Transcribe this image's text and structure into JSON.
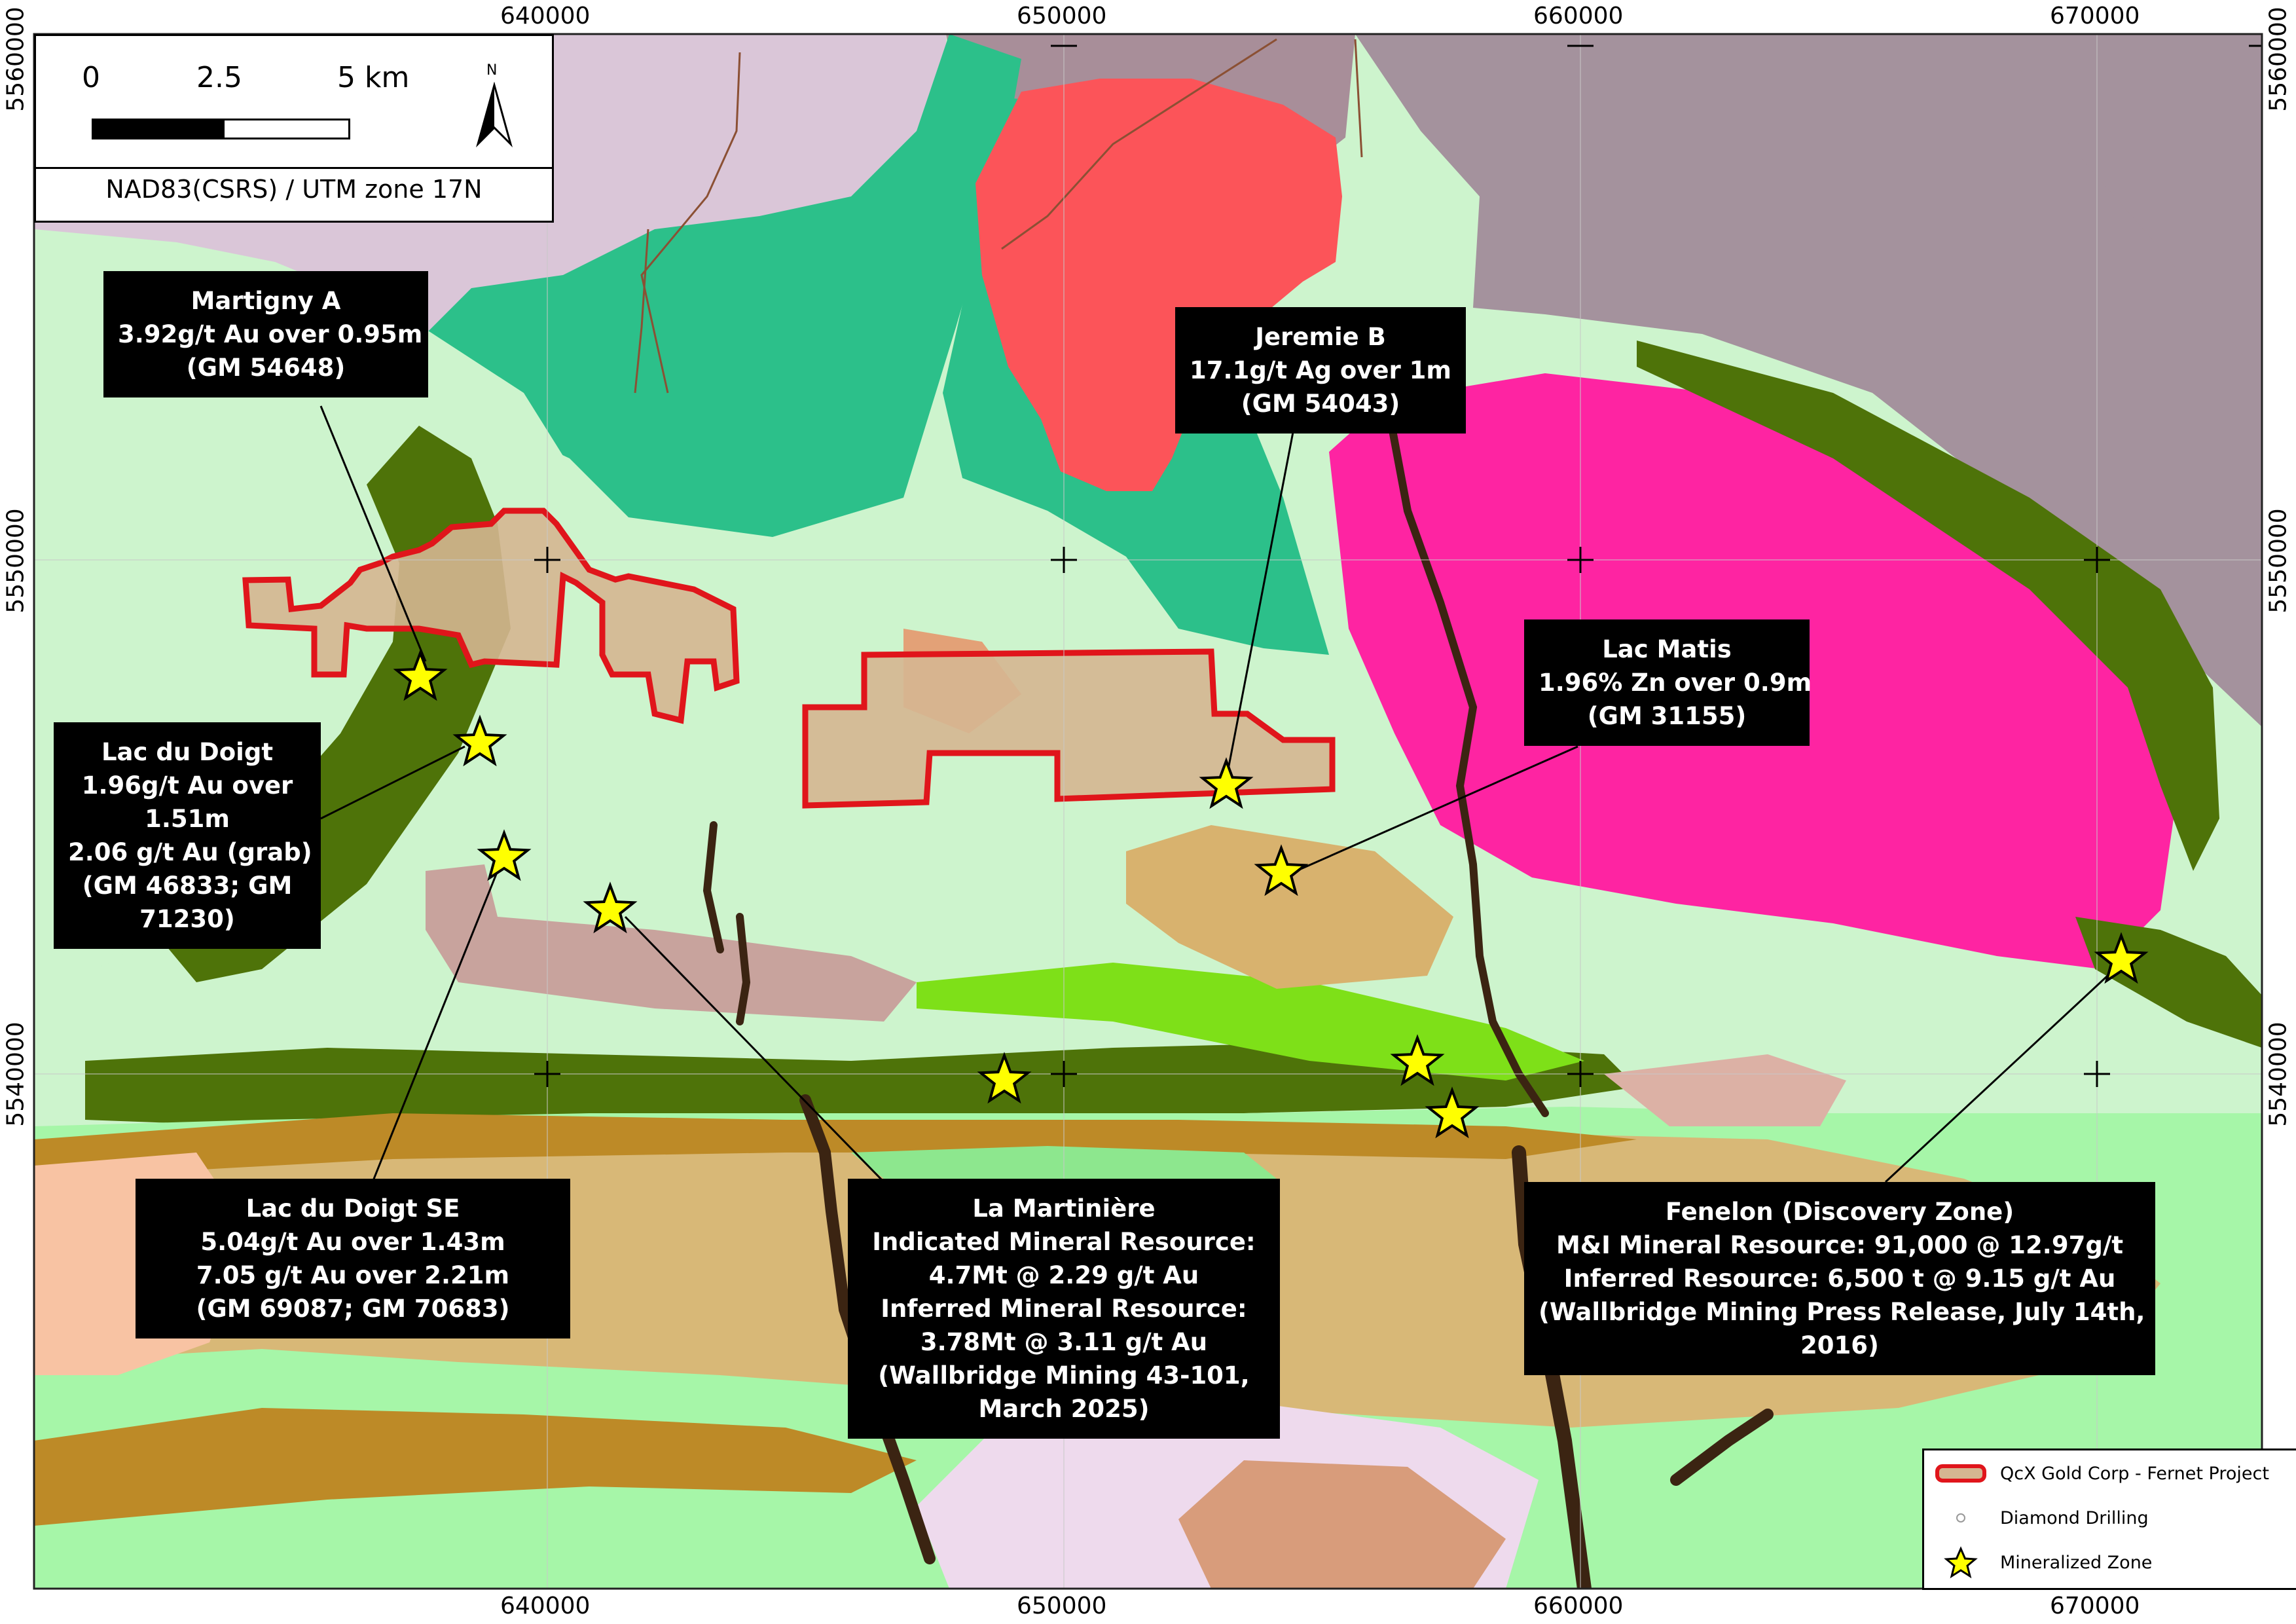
{
  "axes": {
    "x_ticks": [
      "640000",
      "650000",
      "660000",
      "670000"
    ],
    "y_ticks": [
      "5560000",
      "5550000",
      "5540000"
    ]
  },
  "scale_bar": {
    "labels": [
      "0",
      "2.5",
      "5 km"
    ],
    "north": "N",
    "crs": "NAD83(CSRS) / UTM zone 17N"
  },
  "callouts": {
    "martigny_a": [
      "Martigny A",
      "3.92g/t Au over 0.95m",
      "(GM 54648)"
    ],
    "jeremie_b": [
      "Jeremie B",
      "17.1g/t Ag over 1m",
      "(GM 54043)"
    ],
    "lac_matis": [
      "Lac Matis",
      "1.96% Zn over 0.9m",
      "(GM 31155)"
    ],
    "lac_du_doigt": [
      "Lac du Doigt",
      "1.96g/t Au over",
      "1.51m",
      "2.06 g/t Au (grab)",
      "(GM 46833; GM",
      "71230)"
    ],
    "lac_du_doigt_se": [
      "Lac du Doigt SE",
      "5.04g/t Au over 1.43m",
      "7.05 g/t Au over 2.21m",
      "(GM 69087; GM 70683)"
    ],
    "la_martiniere": [
      "La Martinière",
      "Indicated Mineral Resource:",
      "4.7Mt @ 2.29 g/t Au",
      "Inferred Mineral Resource:",
      "3.78Mt @ 3.11 g/t Au",
      "(Wallbridge Mining 43-101,",
      "March 2025)"
    ],
    "fenelon": [
      "Fenelon (Discovery Zone)",
      "M&I Mineral Resource: 91,000 @ 12.97g/t",
      "Inferred Resource: 6,500 t @ 9.15 g/t Au",
      "(Wallbridge Mining Press Release, July 14th,",
      "2016)"
    ]
  },
  "legend": {
    "project": "QcX Gold Corp - Fernet Project",
    "drilling": "Diamond Drilling",
    "zone": "Mineralized Zone"
  },
  "colors": {
    "claim_outline": "#e0151b",
    "star_fill": "#ffff00",
    "callout_bg": "#000000",
    "callout_text": "#ffffff"
  },
  "icons": [
    "north-arrow-icon",
    "star-icon"
  ]
}
